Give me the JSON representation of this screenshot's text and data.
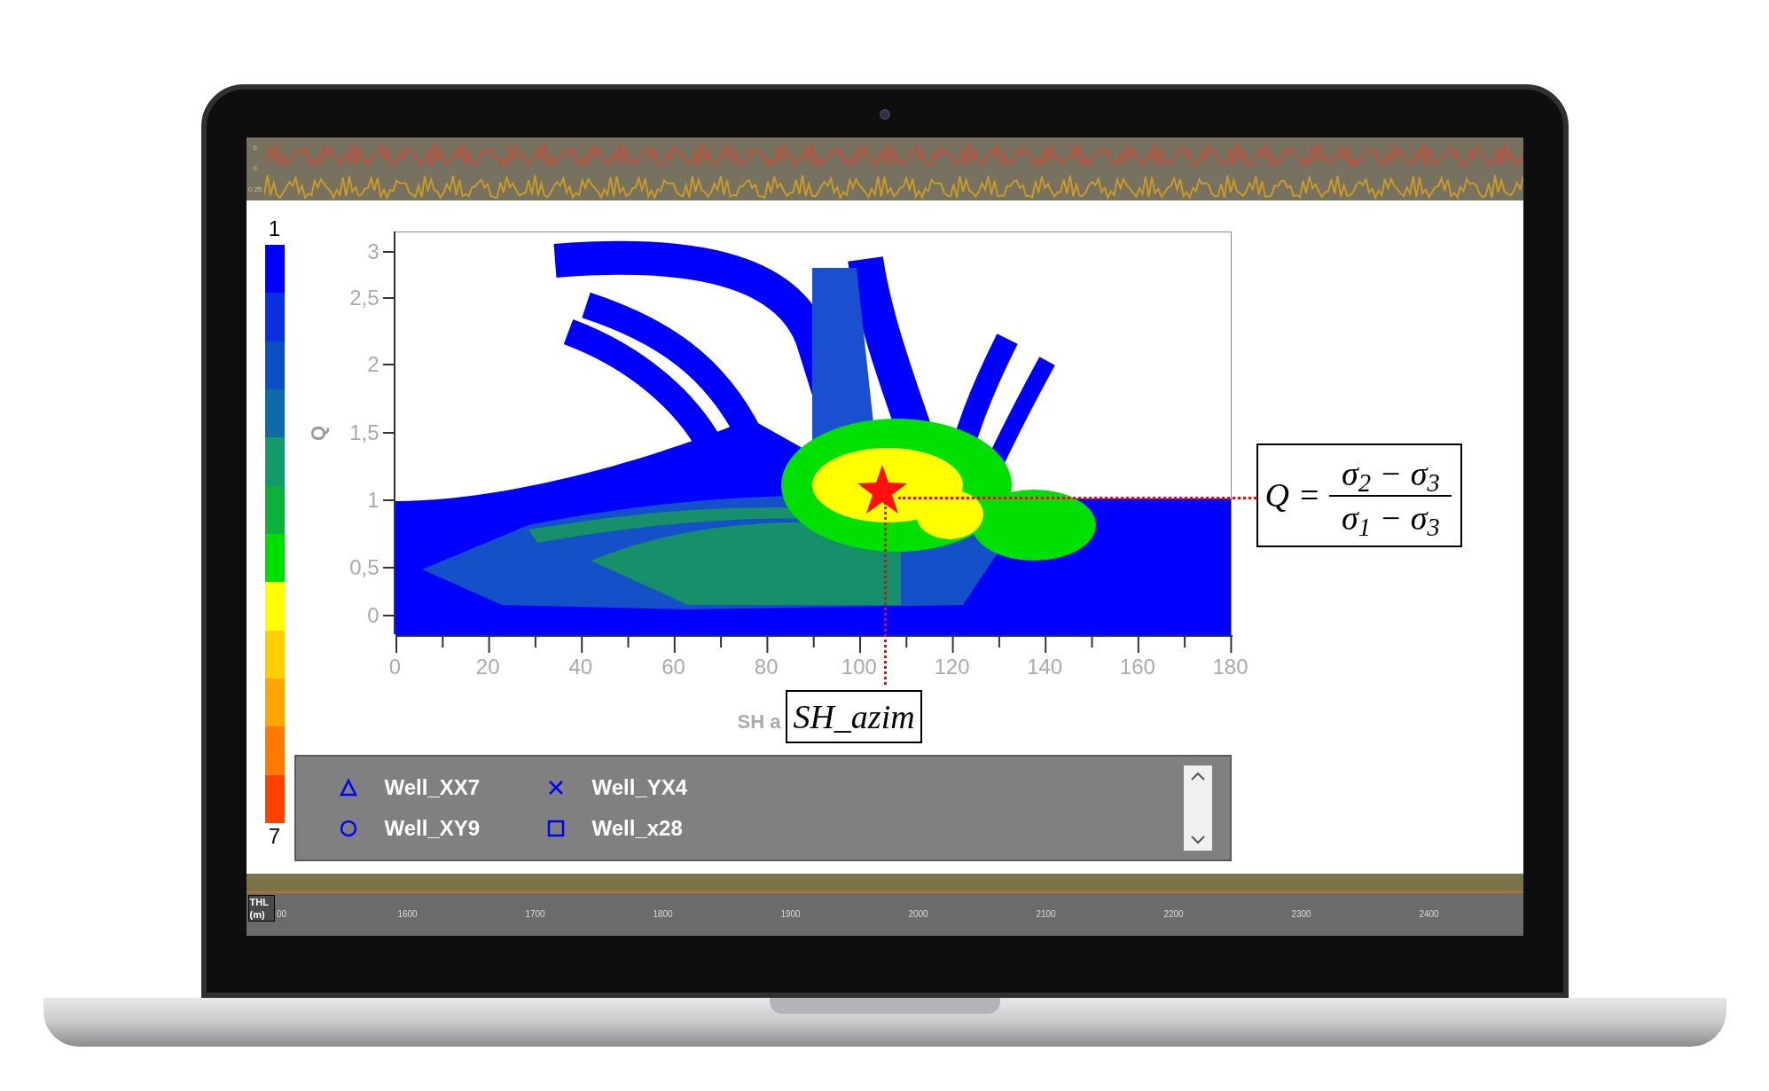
{
  "top_track": {
    "labels": [
      "0",
      "0",
      "0.25"
    ]
  },
  "color_scale": {
    "top_label": "1",
    "bottom_label": "7"
  },
  "chart": {
    "ylabel": "Q",
    "yticks": [
      "3",
      "2,5",
      "2",
      "1,5",
      "1",
      "0,5",
      "0"
    ],
    "xticks": [
      "0",
      "20",
      "40",
      "60",
      "80",
      "100",
      "120",
      "140",
      "160",
      "180"
    ],
    "xlabel": "SH a"
  },
  "axis_callout": "SH_azim",
  "formula": {
    "lhs": "Q",
    "equals": "=",
    "numerator": "σ$_{2}$ − σ$_{3}$",
    "denominator": "σ$_{1}$ − σ$_{3}$"
  },
  "legend": {
    "items": [
      {
        "kind": "triangle",
        "label": "Well_XX7"
      },
      {
        "kind": "cross",
        "label": "Well_YX4"
      },
      {
        "kind": "circle",
        "label": "Well_XY9"
      },
      {
        "kind": "square",
        "label": "Well_x28"
      }
    ]
  },
  "bottom_ruler": {
    "unit_label": "THL (m)",
    "labels": [
      "00",
      "1600",
      "1700",
      "1800",
      "1900",
      "2000",
      "2100",
      "2200",
      "2300",
      "2400"
    ]
  }
}
